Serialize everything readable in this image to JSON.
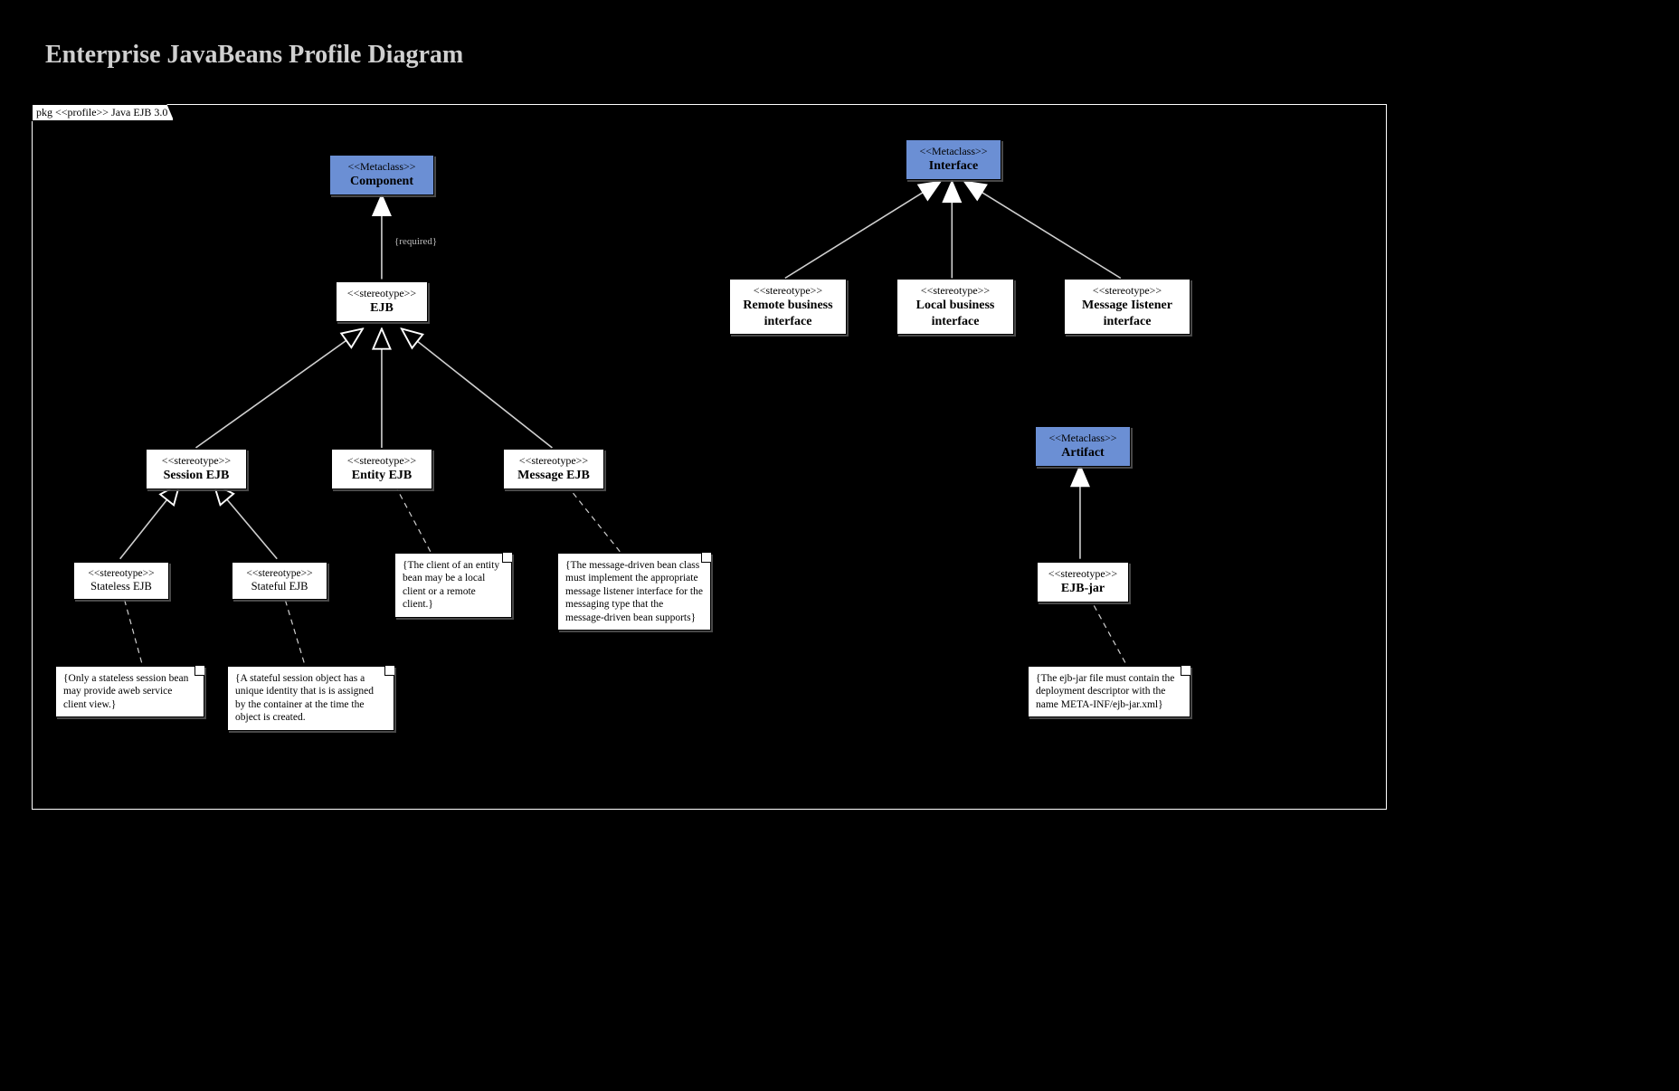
{
  "title": "Enterprise JavaBeans Profile Diagram",
  "package_header": "pkg <<profile>> Java EJB 3.0",
  "required_label": "{required}",
  "metaclasses": {
    "component": {
      "stereo": "<<Metaclass>>",
      "name": "Component"
    },
    "interface": {
      "stereo": "<<Metaclass>>",
      "name": "Interface"
    },
    "artifact": {
      "stereo": "<<Metaclass>>",
      "name": "Artifact"
    }
  },
  "stereotypes": {
    "ejb": {
      "stereo": "<<stereotype>>",
      "name": "EJB"
    },
    "session_ejb": {
      "stereo": "<<stereotype>>",
      "name": "Session EJB"
    },
    "entity_ejb": {
      "stereo": "<<stereotype>>",
      "name": "Entity EJB"
    },
    "message_ejb": {
      "stereo": "<<stereotype>>",
      "name": "Message EJB"
    },
    "stateless_ejb": {
      "stereo": "<<stereotype>>",
      "name": "Stateless EJB"
    },
    "stateful_ejb": {
      "stereo": "<<stereotype>>",
      "name": "Stateful EJB"
    },
    "remote_if": {
      "stereo": "<<stereotype>>",
      "name": "Remote business interface"
    },
    "local_if": {
      "stereo": "<<stereotype>>",
      "name": "Local business interface"
    },
    "msg_listener": {
      "stereo": "<<stereotype>>",
      "name": "Message Iistener interface"
    },
    "ejb_jar": {
      "stereo": "<<stereotype>>",
      "name": "EJB-jar"
    }
  },
  "notes": {
    "stateless": "{Only a stateless session bean may provide aweb service client view.}",
    "stateful": "{A stateful session object has a unique identity that is is assigned by the container at the time the object is created.",
    "entity": "{The client of an entity bean may be a local client or a remote client.}",
    "message": "{The message-driven bean class must implement the appropriate message listener interface for the messaging type that the message-driven bean supports}",
    "ejb_jar": "{The ejb-jar file must contain the deployment descriptor with the name META-INF/ejb-jar.xml}"
  },
  "relationships": [
    {
      "from": "EJB",
      "to": "Component",
      "type": "extension",
      "constraint": "{required}"
    },
    {
      "from": "Session EJB",
      "to": "EJB",
      "type": "generalization"
    },
    {
      "from": "Entity EJB",
      "to": "EJB",
      "type": "generalization"
    },
    {
      "from": "Message EJB",
      "to": "EJB",
      "type": "generalization"
    },
    {
      "from": "Stateless EJB",
      "to": "Session EJB",
      "type": "generalization"
    },
    {
      "from": "Stateful EJB",
      "to": "Session EJB",
      "type": "generalization"
    },
    {
      "from": "Remote business interface",
      "to": "Interface",
      "type": "extension"
    },
    {
      "from": "Local business interface",
      "to": "Interface",
      "type": "extension"
    },
    {
      "from": "Message Iistener interface",
      "to": "Interface",
      "type": "extension"
    },
    {
      "from": "EJB-jar",
      "to": "Artifact",
      "type": "extension"
    },
    {
      "from": "note.stateless",
      "to": "Stateless EJB",
      "type": "anchor"
    },
    {
      "from": "note.stateful",
      "to": "Stateful EJB",
      "type": "anchor"
    },
    {
      "from": "note.entity",
      "to": "Entity EJB",
      "type": "anchor"
    },
    {
      "from": "note.message",
      "to": "Message EJB",
      "type": "anchor"
    },
    {
      "from": "note.ejb_jar",
      "to": "EJB-jar",
      "type": "anchor"
    }
  ]
}
